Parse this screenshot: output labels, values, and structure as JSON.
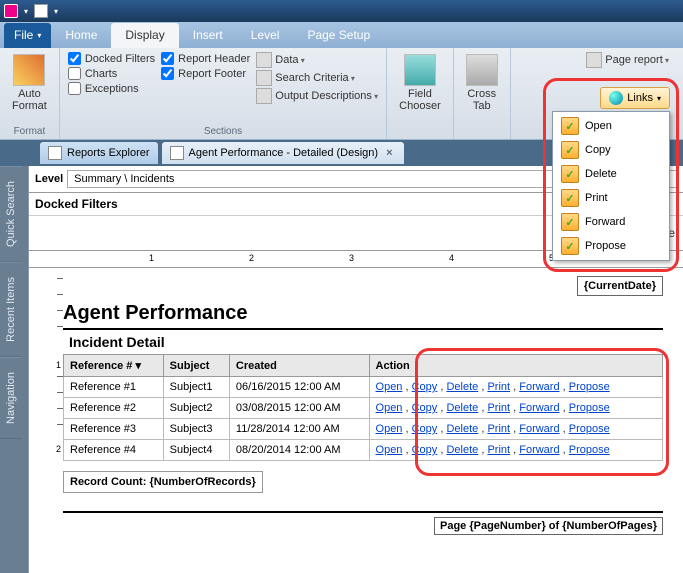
{
  "titlebar": {
    "app_icon": "oracle"
  },
  "ribbon_tabs": {
    "file": "File",
    "items": [
      "Home",
      "Display",
      "Insert",
      "Level",
      "Page Setup"
    ],
    "active_index": 1
  },
  "ribbon": {
    "format": {
      "label": "Format",
      "auto_format": "Auto\nFormat"
    },
    "sections": {
      "label": "Sections",
      "docked_filters": "Docked Filters",
      "charts": "Charts",
      "exceptions": "Exceptions",
      "report_header": "Report Header",
      "report_footer": "Report Footer",
      "data": "Data",
      "search_criteria": "Search Criteria",
      "output_descriptions": "Output Descriptions"
    },
    "field_chooser": "Field\nChooser",
    "cross_tab": "Cross\nTab",
    "page_report": "Page report",
    "links_label": "Links"
  },
  "links_menu": [
    "Open",
    "Copy",
    "Delete",
    "Print",
    "Forward",
    "Propose"
  ],
  "doc_tabs": {
    "reports_explorer": "Reports Explorer",
    "agent_perf": "Agent Performance - Detailed (Design)"
  },
  "side_tabs": [
    "Quick Search",
    "Recent Items",
    "Navigation"
  ],
  "level_bar": {
    "label": "Level",
    "path": "Summary \\ Incidents"
  },
  "docked_filters_label": "Docked Filters",
  "drop_msg": "Drop Fields from the",
  "current_date": "{CurrentDate}",
  "report_title": "Agent Performance",
  "section_title": "Incident Detail",
  "columns": {
    "ref": "Reference #",
    "subject": "Subject",
    "created": "Created",
    "action": "Action"
  },
  "actions": [
    "Open",
    "Copy",
    "Delete",
    "Print",
    "Forward",
    "Propose"
  ],
  "rows": [
    {
      "ref": "Reference #1",
      "subject": "Subject1",
      "created": "06/16/2015 12:00 AM"
    },
    {
      "ref": "Reference #2",
      "subject": "Subject2",
      "created": "03/08/2015 12:00 AM"
    },
    {
      "ref": "Reference #3",
      "subject": "Subject3",
      "created": "11/28/2014 12:00 AM"
    },
    {
      "ref": "Reference #4",
      "subject": "Subject4",
      "created": "08/20/2014 12:00 AM"
    }
  ],
  "record_count": "Record Count: {NumberOfRecords}",
  "page_footer": "Page {PageNumber} of {NumberOfPages}",
  "chart_data": {
    "type": "table",
    "columns": [
      "Reference #",
      "Subject",
      "Created",
      "Action"
    ],
    "rows": [
      [
        "Reference #1",
        "Subject1",
        "06/16/2015 12:00 AM",
        "Open|Copy|Delete|Print|Forward|Propose"
      ],
      [
        "Reference #2",
        "Subject2",
        "03/08/2015 12:00 AM",
        "Open|Copy|Delete|Print|Forward|Propose"
      ],
      [
        "Reference #3",
        "Subject3",
        "11/28/2014 12:00 AM",
        "Open|Copy|Delete|Print|Forward|Propose"
      ],
      [
        "Reference #4",
        "Subject4",
        "08/20/2014 12:00 AM",
        "Open|Copy|Delete|Print|Forward|Propose"
      ]
    ]
  }
}
